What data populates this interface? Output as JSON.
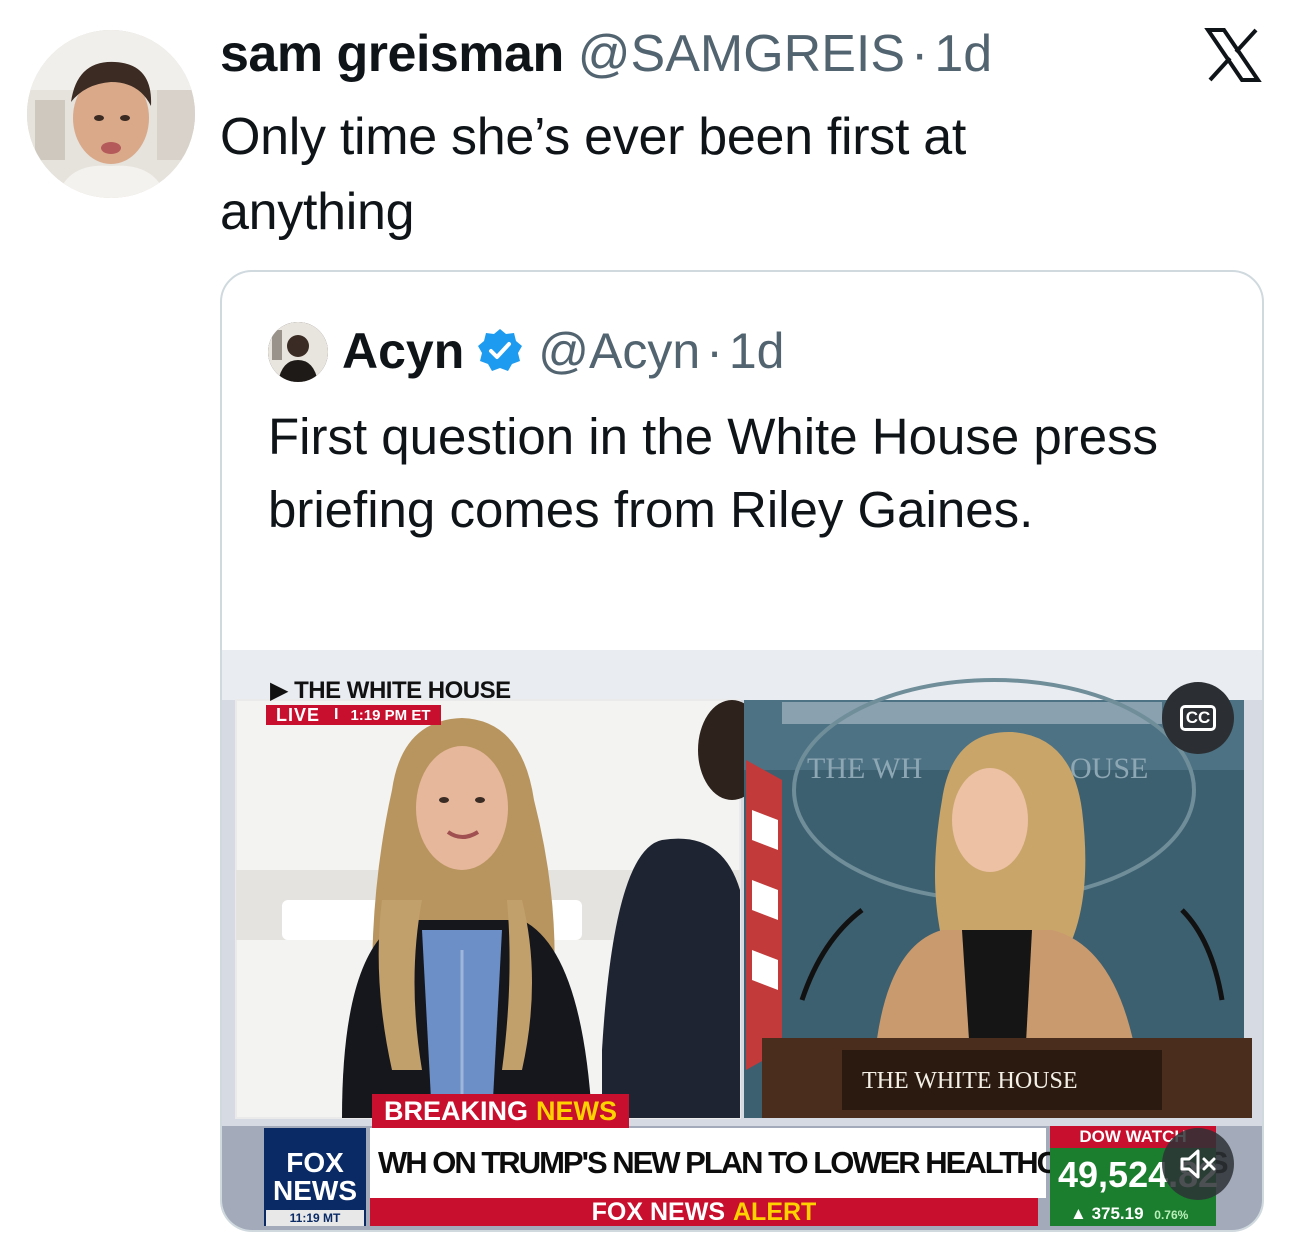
{
  "tweet": {
    "author_name": "sam greisman",
    "author_handle": "@SAMGREIS",
    "separator": "·",
    "time": "1d",
    "text": "Only time she’s ever been first at anything"
  },
  "platform_logo_icon": "x-logo-icon",
  "quoted_tweet": {
    "author_name": "Acyn",
    "verified_icon": "verified-badge-icon",
    "author_handle": "@Acyn",
    "separator": "·",
    "time": "1d",
    "text": "First question in the White House press briefing comes from Riley Gaines."
  },
  "video": {
    "top_label": "THE WHITE HOUSE",
    "live_word": "LIVE",
    "live_separator": "I",
    "live_time": "1:19 PM ET",
    "backdrop_text_left": "THE WH",
    "backdrop_text_right": "OUSE",
    "podium_text": "THE WHITE HOUSE",
    "breaking_word1": "BREAKING",
    "breaking_word2": "NEWS",
    "headline": "WH ON TRUMP'S NEW PLAN TO LOWER HEALTHCARE PRICES",
    "alert_word1": "FOX NEWS",
    "alert_word2": "ALERT",
    "network_line1": "FOX",
    "network_line2": "NEWS",
    "network_time": "11:19 MT",
    "dow_label": "DOW WATCH",
    "dow_value": "49,524.82",
    "dow_change": "375.19",
    "dow_change_pct": "0.76%",
    "cc_label": "CC",
    "cc_icon": "closed-captions-icon",
    "mute_icon": "volume-muted-icon"
  },
  "colors": {
    "text_primary": "#0f1419",
    "text_secondary": "#536471",
    "border": "#cfd9de",
    "verified_blue": "#1d9bf0",
    "fox_red": "#c8102e",
    "fox_navy": "#0a2a66",
    "dow_green": "#1b7d2e"
  }
}
